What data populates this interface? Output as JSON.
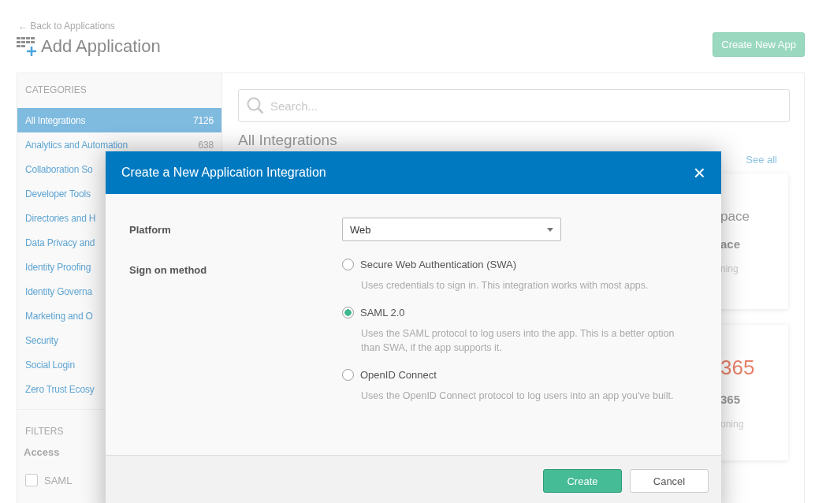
{
  "back_link": "← Back to Applications",
  "page_title": "Add Application",
  "create_button": "Create New App",
  "sidebar": {
    "categories_heading": "CATEGORIES",
    "items": [
      {
        "label": "All Integrations",
        "count": "7126",
        "selected": true
      },
      {
        "label": "Analytics and Automation",
        "count": "638",
        "selected": false
      },
      {
        "label": "Collaboration So",
        "selected": false
      },
      {
        "label": "Developer Tools",
        "selected": false
      },
      {
        "label": "Directories and H",
        "selected": false
      },
      {
        "label": "Data Privacy and",
        "selected": false
      },
      {
        "label": "Identity Proofing",
        "selected": false
      },
      {
        "label": "Identity Governa",
        "selected": false
      },
      {
        "label": "Marketing and O",
        "selected": false
      },
      {
        "label": "Security",
        "selected": false
      },
      {
        "label": "Social Login",
        "selected": false
      },
      {
        "label": "Zero Trust Ecosy",
        "selected": false
      }
    ],
    "filters_heading": "FILTERS",
    "access_heading": "Access",
    "filters": [
      {
        "label": "SAML",
        "checked": false
      }
    ]
  },
  "search": {
    "placeholder": "Search..."
  },
  "section": {
    "title": "All Integrations",
    "see_all": "See all"
  },
  "cards": [
    {
      "logo_text": "pace",
      "name": "ace",
      "caption": "ning",
      "color": "#9a9a9a"
    },
    {
      "logo_text": "365",
      "name": "365",
      "caption": "oning",
      "color": "#e8806a"
    }
  ],
  "modal": {
    "title": "Create a New Application Integration",
    "close": "×",
    "platform_label": "Platform",
    "platform_value": "Web",
    "method_label": "Sign on method",
    "options": [
      {
        "label": "Secure Web Authentication (SWA)",
        "description": "Uses credentials to sign in. This integration works with most apps.",
        "selected": false
      },
      {
        "label": "SAML 2.0",
        "description": "Uses the SAML protocol to log users into the app. This is a better option than SWA, if the app supports it.",
        "selected": true
      },
      {
        "label": "OpenID Connect",
        "description": "Uses the OpenID Connect protocol to log users into an app you've built.",
        "selected": false
      }
    ],
    "buttons": [
      "Create",
      "Cancel"
    ]
  }
}
